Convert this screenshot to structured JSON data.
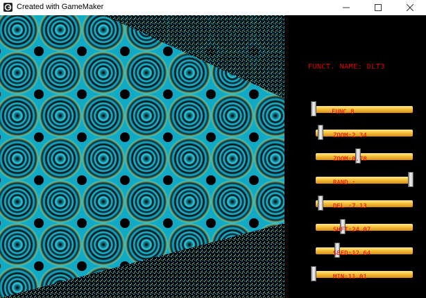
{
  "window": {
    "title": "Created with GameMaker",
    "controls": [
      "minimize",
      "maximize",
      "close"
    ],
    "app_icon": "gamemaker-icon"
  },
  "render": {
    "pattern": "moire-interference-pattern",
    "colors": {
      "primary": "#1ec8e6",
      "secondary": "#0a2a35",
      "accent": "#6fa36a",
      "background": "#000000"
    }
  },
  "panel": {
    "function_name": "FUNCT. NAME: DLT3",
    "sliders": [
      {
        "label": "FUNC.8",
        "value": 0.0
      },
      {
        "label": "ZOOM:2.34",
        "value": 0.07
      },
      {
        "label": "ZOOM:0.78",
        "value": 0.46
      },
      {
        "label": "RAND.: ",
        "value": 1.0
      },
      {
        "label": "DEL.:7.13",
        "value": 0.07
      },
      {
        "label": "SHFT:24.07",
        "value": 0.3
      },
      {
        "label": "SEED:12.64",
        "value": 0.24
      },
      {
        "label": "MIN:11.01",
        "value": 0.0
      }
    ],
    "colors": {
      "label": "#e00000",
      "track": "#f6c23c"
    }
  }
}
